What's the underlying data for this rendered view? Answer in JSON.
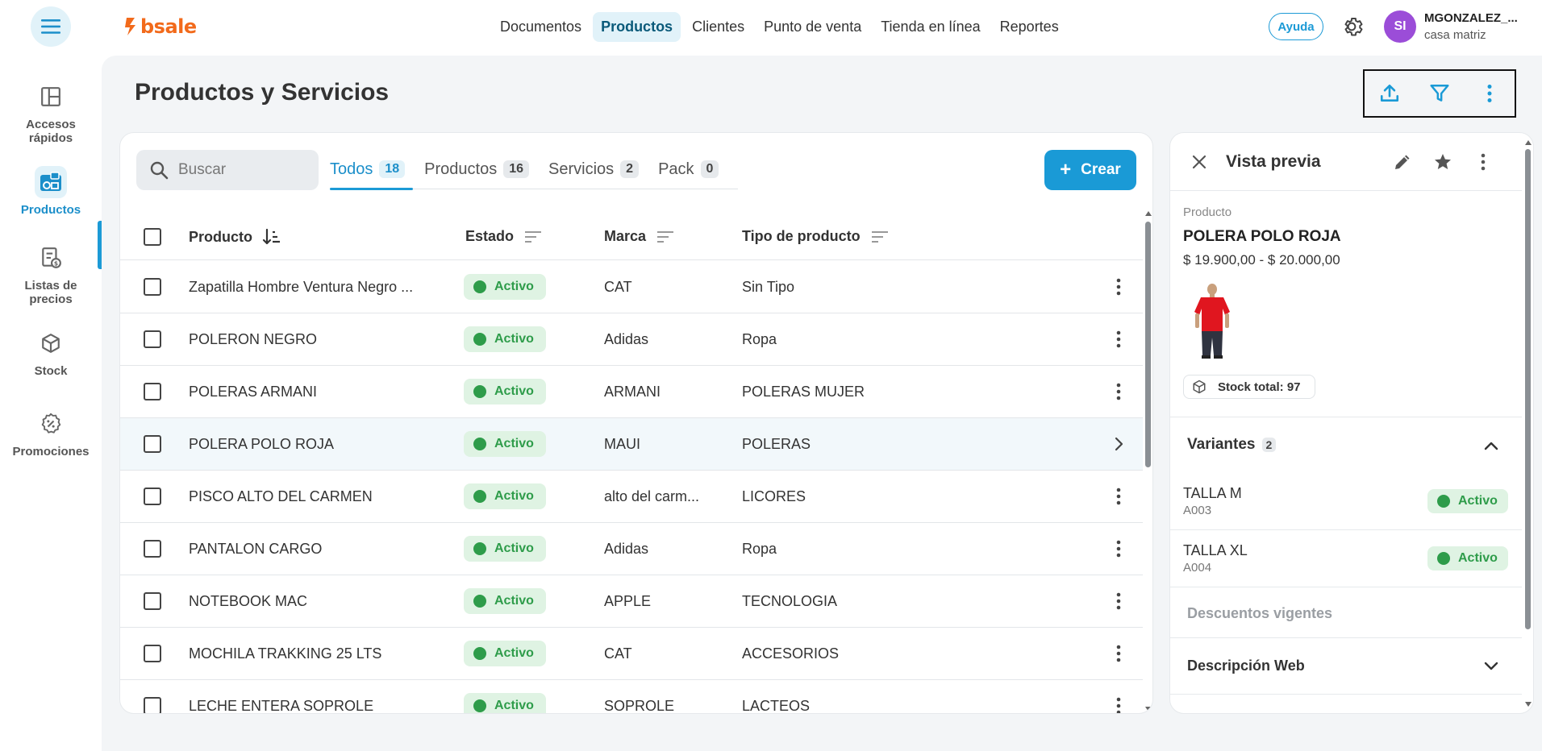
{
  "header": {
    "logo_text": "bsale",
    "nav": [
      {
        "label": "Documentos",
        "active": false
      },
      {
        "label": "Productos",
        "active": true
      },
      {
        "label": "Clientes",
        "active": false
      },
      {
        "label": "Punto de venta",
        "active": false
      },
      {
        "label": "Tienda en línea",
        "active": false
      },
      {
        "label": "Reportes",
        "active": false
      }
    ],
    "help_label": "Ayuda",
    "avatar_initials": "SI",
    "user_name": "MGONZALEZ_...",
    "user_branch": "casa matriz"
  },
  "sidebar": {
    "items": [
      {
        "label": "Accesos rápidos",
        "icon": "layout-icon",
        "active": false
      },
      {
        "label": "Productos",
        "icon": "products-icon",
        "active": true
      },
      {
        "label": "Listas de precios",
        "icon": "price-list-icon",
        "active": false
      },
      {
        "label": "Stock",
        "icon": "box-icon",
        "active": false
      },
      {
        "label": "Promociones",
        "icon": "discount-icon",
        "active": false
      }
    ]
  },
  "page": {
    "title": "Productos y Servicios"
  },
  "toolbar": {
    "search_placeholder": "Buscar",
    "tabs": [
      {
        "label": "Todos",
        "count": "18",
        "active": true
      },
      {
        "label": "Productos",
        "count": "16",
        "active": false
      },
      {
        "label": "Servicios",
        "count": "2",
        "active": false
      },
      {
        "label": "Pack",
        "count": "0",
        "active": false
      }
    ],
    "create_label": "Crear"
  },
  "table": {
    "columns": [
      "Producto",
      "Estado",
      "Marca",
      "Tipo de producto"
    ],
    "rows": [
      {
        "producto": "Zapatilla Hombre Ventura Negro ...",
        "estado": "Activo",
        "marca": "CAT",
        "tipo": "Sin Tipo"
      },
      {
        "producto": "POLERON NEGRO",
        "estado": "Activo",
        "marca": "Adidas",
        "tipo": "Ropa"
      },
      {
        "producto": "POLERAS ARMANI",
        "estado": "Activo",
        "marca": "ARMANI",
        "tipo": "POLERAS MUJER"
      },
      {
        "producto": "POLERA POLO ROJA",
        "estado": "Activo",
        "marca": "MAUI",
        "tipo": "POLERAS",
        "selected": true
      },
      {
        "producto": "PISCO ALTO DEL CARMEN",
        "estado": "Activo",
        "marca": "alto del carm...",
        "tipo": "LICORES"
      },
      {
        "producto": "PANTALON CARGO",
        "estado": "Activo",
        "marca": "Adidas",
        "tipo": "Ropa"
      },
      {
        "producto": "NOTEBOOK MAC",
        "estado": "Activo",
        "marca": "APPLE",
        "tipo": "TECNOLOGIA"
      },
      {
        "producto": "MOCHILA TRAKKING 25 LTS",
        "estado": "Activo",
        "marca": "CAT",
        "tipo": "ACCESORIOS"
      },
      {
        "producto": "LECHE ENTERA SOPROLE",
        "estado": "Activo",
        "marca": "SOPROLE",
        "tipo": "LACTEOS"
      }
    ]
  },
  "preview": {
    "title": "Vista previa",
    "section_label": "Producto",
    "product_name": "POLERA POLO ROJA",
    "price_range": "$ 19.900,00 - $ 20.000,00",
    "stock_label": "Stock total: 97",
    "variants_label": "Variantes",
    "variants_count": "2",
    "variants": [
      {
        "name": "TALLA M",
        "sku": "A003",
        "status": "Activo"
      },
      {
        "name": "TALLA XL",
        "sku": "A004",
        "status": "Activo"
      }
    ],
    "discounts_label": "Descuentos vigentes",
    "web_description_label": "Descripción Web"
  },
  "colors": {
    "accent": "#1a9ad6",
    "brand": "#f26a1b",
    "status_green": "#2e9c4a",
    "status_bg": "#dff3e3",
    "avatar": "#9b4dd8"
  }
}
